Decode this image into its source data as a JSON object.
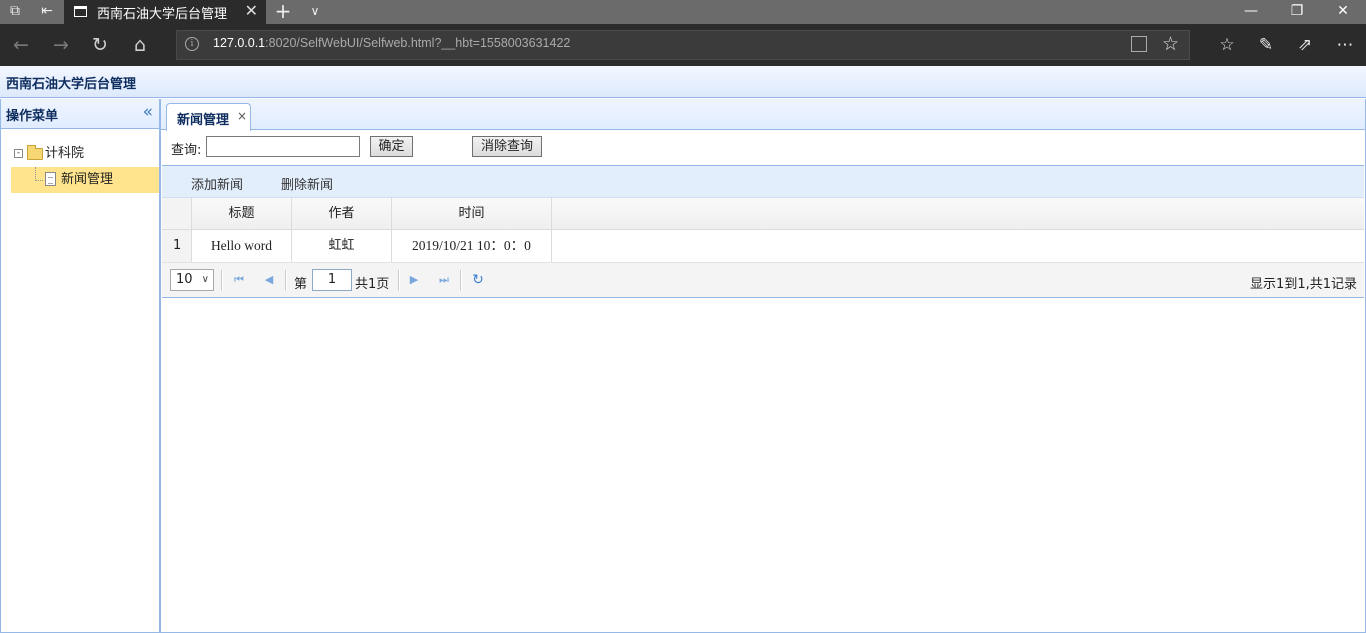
{
  "browser": {
    "tab_title": "西南石油大学后台管理",
    "url_host": "127.0.0.1",
    "url_rest": ":8020/SelfWebUI/Selfweb.html?__hbt=1558003631422"
  },
  "app": {
    "title": "西南石油大学后台管理"
  },
  "sidebar": {
    "title": "操作菜单",
    "tree": [
      {
        "label": "计科院"
      },
      {
        "label": "新闻管理"
      }
    ]
  },
  "tabs": [
    {
      "label": "新闻管理",
      "close": "×"
    }
  ],
  "query": {
    "label": "查询:",
    "value": "",
    "confirm_label": "确定",
    "clear_label": "消除查询"
  },
  "toolbar": {
    "add_label": "添加新闻",
    "delete_label": "删除新闻"
  },
  "grid": {
    "columns": [
      "标题",
      "作者",
      "时间"
    ],
    "rows": [
      {
        "num": "1",
        "title": "Hello word",
        "author": "虹虹",
        "time": "2019/10/21 10：0：0"
      }
    ]
  },
  "pager": {
    "page_size": "10",
    "page_prefix": "第",
    "current_page": "1",
    "page_suffix": "共1页",
    "info": "显示1到1,共1记录"
  },
  "colors": {
    "accent": "#95b8e7",
    "header_bg": "#e0ecff",
    "selected_node": "#ffe48d"
  }
}
